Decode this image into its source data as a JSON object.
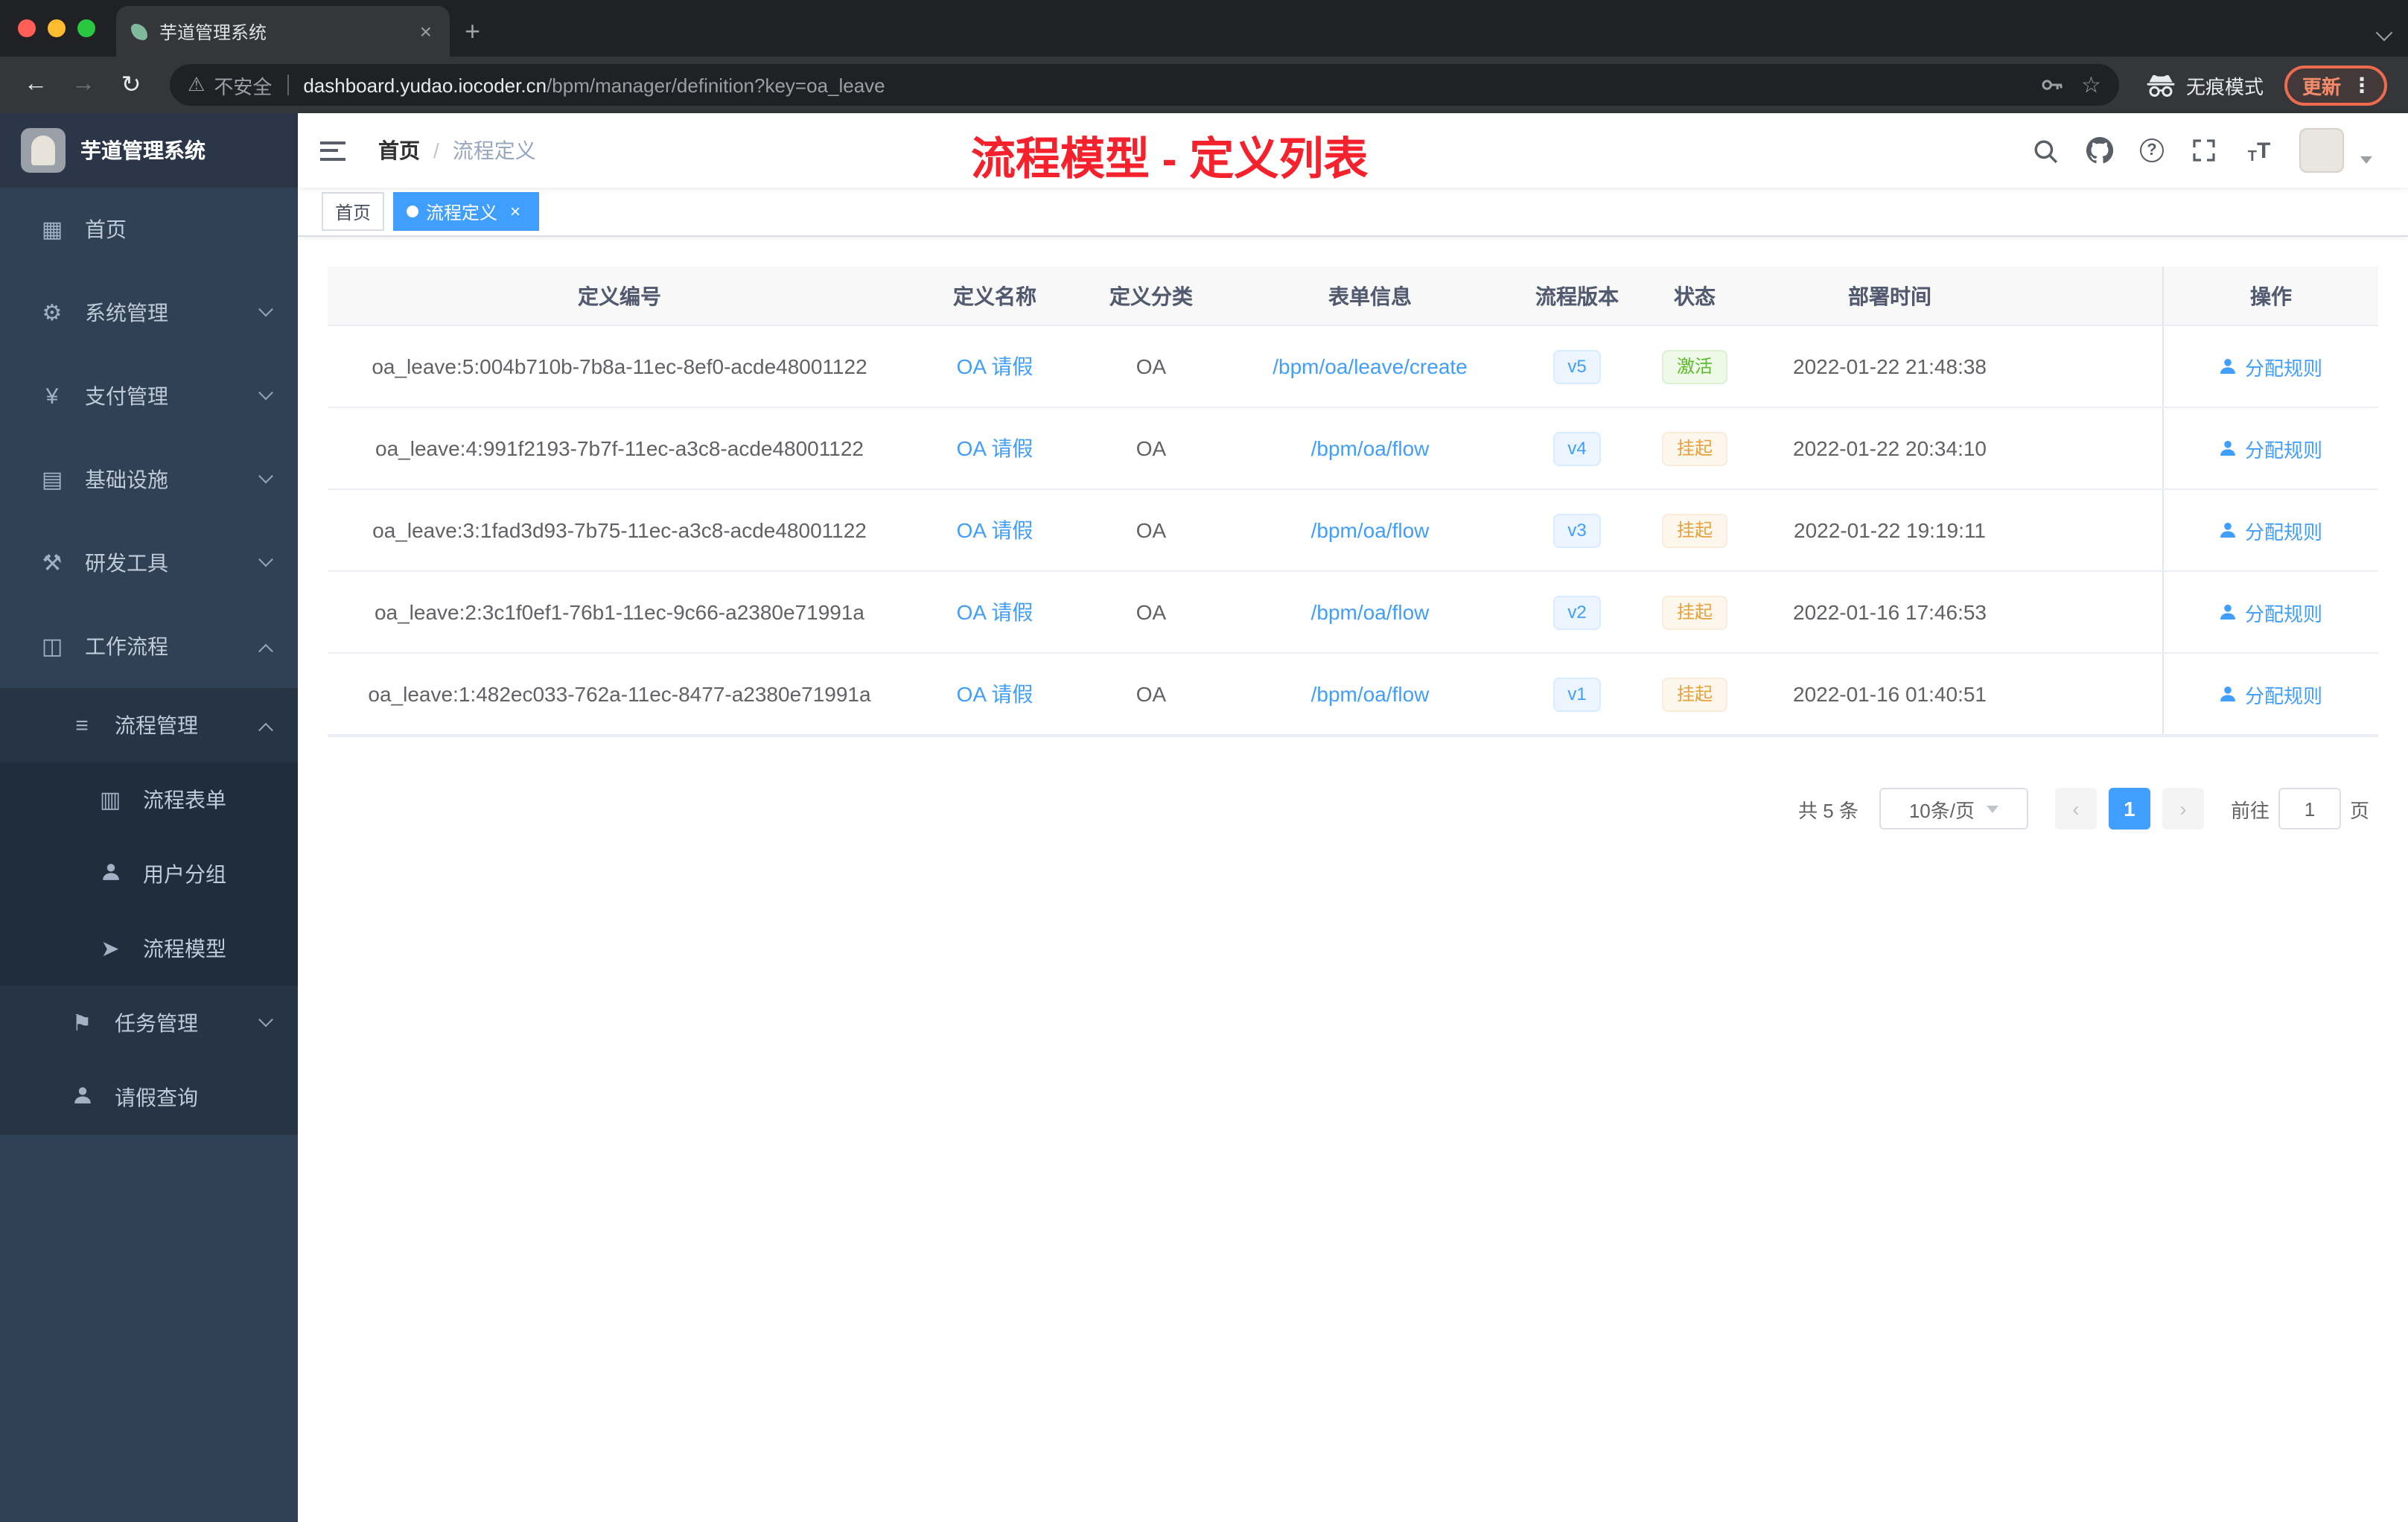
{
  "browser": {
    "tab_title": "芋道管理系统",
    "security_label": "不安全",
    "url_domain": "dashboard.yudao.iocoder.cn",
    "url_path": "/bpm/manager/definition?key=oa_leave",
    "incognito_label": "无痕模式",
    "update_label": "更新"
  },
  "sidebar": {
    "logo_title": "芋道管理系统",
    "items": [
      {
        "label": "首页"
      },
      {
        "label": "系统管理"
      },
      {
        "label": "支付管理"
      },
      {
        "label": "基础设施"
      },
      {
        "label": "研发工具"
      },
      {
        "label": "工作流程"
      },
      {
        "label": "流程管理"
      },
      {
        "label": "流程表单"
      },
      {
        "label": "用户分组"
      },
      {
        "label": "流程模型"
      },
      {
        "label": "任务管理"
      },
      {
        "label": "请假查询"
      }
    ]
  },
  "header": {
    "breadcrumb": [
      "首页",
      "流程定义"
    ],
    "breadcrumb_separator": "/",
    "annotation": "流程模型 - 定义列表"
  },
  "tags": [
    {
      "label": "首页"
    },
    {
      "label": "流程定义"
    }
  ],
  "table": {
    "headers": [
      "定义编号",
      "定义名称",
      "定义分类",
      "表单信息",
      "流程版本",
      "状态",
      "部署时间",
      "操作"
    ],
    "rows": [
      {
        "id": "oa_leave:5:004b710b-7b8a-11ec-8ef0-acde48001122",
        "name": "OA 请假",
        "category": "OA",
        "form": "/bpm/oa/leave/create",
        "version": "v5",
        "status": "激活",
        "time": "2022-01-22 21:48:38",
        "action": "分配规则"
      },
      {
        "id": "oa_leave:4:991f2193-7b7f-11ec-a3c8-acde48001122",
        "name": "OA 请假",
        "category": "OA",
        "form": "/bpm/oa/flow",
        "version": "v4",
        "status": "挂起",
        "time": "2022-01-22 20:34:10",
        "action": "分配规则"
      },
      {
        "id": "oa_leave:3:1fad3d93-7b75-11ec-a3c8-acde48001122",
        "name": "OA 请假",
        "category": "OA",
        "form": "/bpm/oa/flow",
        "version": "v3",
        "status": "挂起",
        "time": "2022-01-22 19:19:11",
        "action": "分配规则"
      },
      {
        "id": "oa_leave:2:3c1f0ef1-76b1-11ec-9c66-a2380e71991a",
        "name": "OA 请假",
        "category": "OA",
        "form": "/bpm/oa/flow",
        "version": "v2",
        "status": "挂起",
        "time": "2022-01-16 17:46:53",
        "action": "分配规则"
      },
      {
        "id": "oa_leave:1:482ec033-762a-11ec-8477-a2380e71991a",
        "name": "OA 请假",
        "category": "OA",
        "form": "/bpm/oa/flow",
        "version": "v1",
        "status": "挂起",
        "time": "2022-01-16 01:40:51",
        "action": "分配规则"
      }
    ]
  },
  "pagination": {
    "total": "共 5 条",
    "page_size": "10条/页",
    "page": "1",
    "goto_prefix": "前往",
    "goto_value": "1",
    "goto_suffix": "页"
  },
  "icons": {
    "home": "▦",
    "system": "⚙",
    "pay": "¥",
    "infra": "▤",
    "devtool": "⚒",
    "workflow": "◫",
    "process_mgmt": "≡",
    "process_form": "▥",
    "process_model": "➤",
    "task_mgmt": "⚑",
    "back": "←",
    "forward": "→",
    "reload": "↻",
    "warning": "⚠",
    "star": "☆",
    "dots": "⋮",
    "close": "×",
    "plus": "+",
    "prev": "‹",
    "next": "›",
    "question": "?",
    "font_size": "T"
  },
  "colors": {
    "accent": "#409eff",
    "status_active": "#5cbb2a",
    "status_suspended": "#e6a23c",
    "annotation_red": "#f5222d",
    "sidebar_bg": "#304156"
  }
}
